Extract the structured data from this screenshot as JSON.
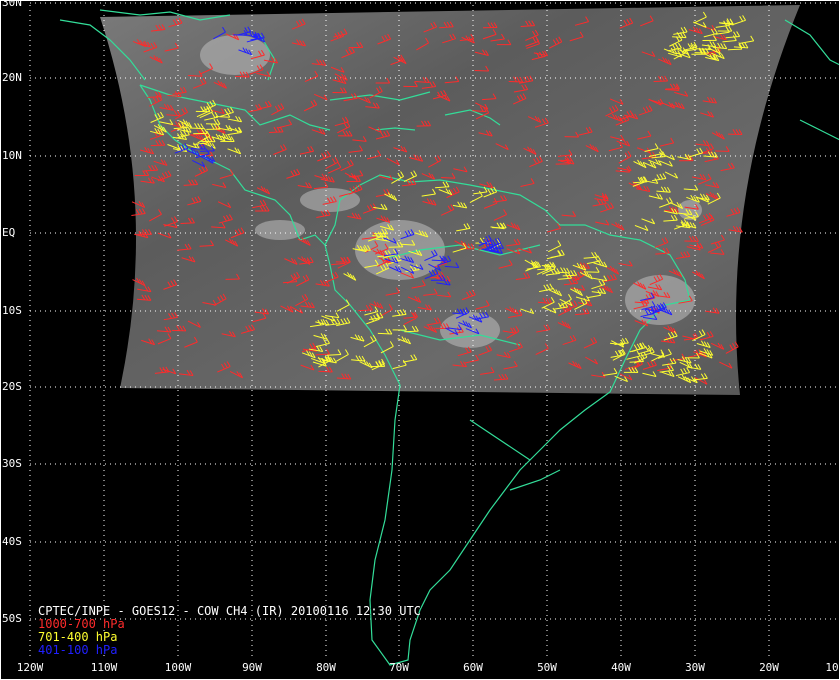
{
  "title": "CPTEC/INPE - GOES12 - COW CH4 (IR) 20100116 12:30 UTC",
  "legend": [
    {
      "label": "1000-700 hPa",
      "color": "#ff2b2b"
    },
    {
      "label": "701-400 hPa",
      "color": "#ffff30"
    },
    {
      "label": "401-100 hPa",
      "color": "#2020ff"
    }
  ],
  "lat_labels": [
    "30N",
    "20N",
    "10N",
    "EQ",
    "10S",
    "20S",
    "30S",
    "40S",
    "50S"
  ],
  "lon_labels": [
    "120W",
    "110W",
    "100W",
    "90W",
    "80W",
    "70W",
    "60W",
    "50W",
    "40W",
    "30W",
    "20W",
    "10"
  ],
  "colors": {
    "coast": "#33dd99",
    "grid": "#ffffff",
    "background": "#000000"
  }
}
